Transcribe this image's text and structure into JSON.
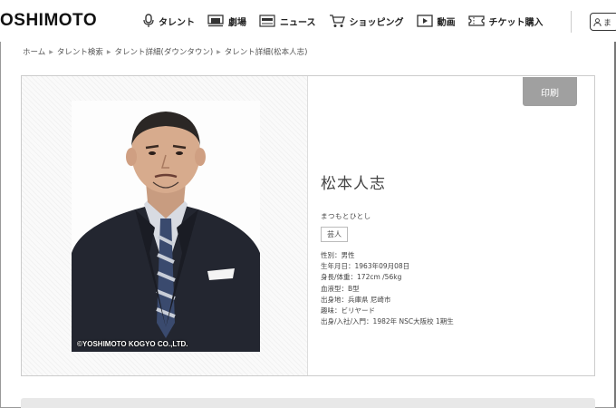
{
  "header": {
    "logo": "OSHIMOTO",
    "nav": [
      {
        "label": "タレント",
        "icon": "microphone-icon"
      },
      {
        "label": "劇場",
        "icon": "theater-icon"
      },
      {
        "label": "ニュース",
        "icon": "news-icon"
      },
      {
        "label": "ショッピング",
        "icon": "cart-icon"
      },
      {
        "label": "動画",
        "icon": "video-icon"
      },
      {
        "label": "チケット購入",
        "icon": "ticket-icon"
      }
    ],
    "user_button": "ま"
  },
  "breadcrumb": [
    "ホーム",
    "タレント検索",
    "タレント詳細(ダウンタウン)",
    "タレント詳細(松本人志)"
  ],
  "profile": {
    "print_label": "印刷",
    "copyright": "©YOSHIMOTO KOGYO CO.,LTD.",
    "name": "松本人志",
    "kana": "まつもとひとし",
    "category": "芸人",
    "details": [
      "性別：男性",
      "生年月日：1963年09月08日",
      "身長/体重：172cm /56kg",
      "血液型：B型",
      "出身地：兵庫県 尼崎市",
      "趣味：ビリヤード",
      "出身/入社/入門：1982年 NSC大阪校 1期生"
    ]
  },
  "colors": {
    "print_button": "#a0a0a0",
    "border": "#cccccc"
  }
}
